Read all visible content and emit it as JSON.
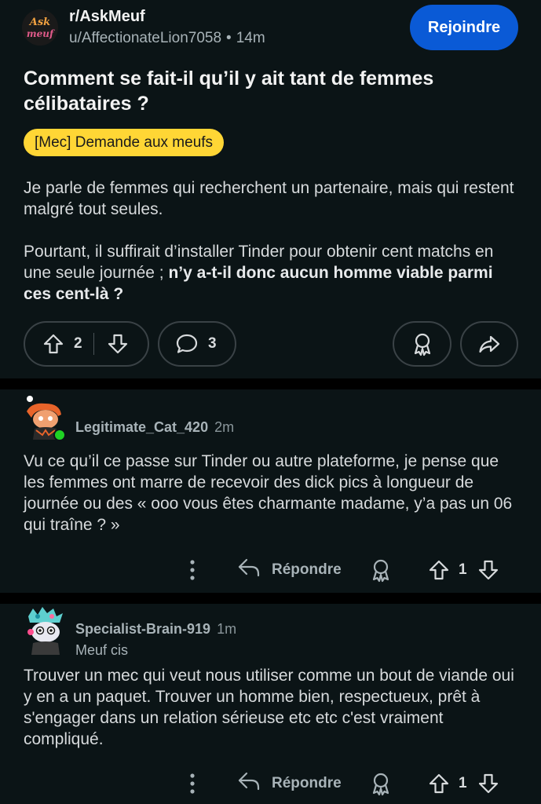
{
  "post": {
    "subreddit": "r/AskMeuf",
    "subreddit_logo_text": "Ask Meuf",
    "author": "u/AffectionateLion7058",
    "separator": "•",
    "time": "14m",
    "join_label": "Rejoindre",
    "title": "Comment se fait-il qu’il y ait tant de femmes célibataires ?",
    "flair": "[Mec] Demande aux meufs",
    "body_p1": "Je parle de femmes qui recherchent un partenaire, mais qui restent malgré tout seules.",
    "body_p2_plain": "Pourtant, il suffirait d’installer Tinder pour obtenir cent matchs en une seule journée ; ",
    "body_p2_bold": "n’y a-t-il donc aucun homme viable parmi ces cent-là ?",
    "score": "2",
    "comment_count": "3",
    "icons": [
      "upvote-icon",
      "downvote-icon",
      "comment-icon",
      "award-icon",
      "share-icon"
    ]
  },
  "comments": [
    {
      "username": "Legitimate_Cat_420",
      "time": "2m",
      "flair": "",
      "body": "Vu ce qu’il ce passe sur Tinder ou autre plateforme, je pense que les femmes ont marre de recevoir des dick pics à longueur de journée ou des « ooo vous êtes charmante madame, y’a pas un 06 qui traîne ? »",
      "reply_label": "Répondre",
      "score": "1",
      "online": true,
      "avatar_colors": {
        "hat": "#e8642a",
        "skin": "#f0a070",
        "shirt": "#2a2a2a"
      }
    },
    {
      "username": "Specialist-Brain-919",
      "time": "1m",
      "flair": "Meuf cis",
      "body": "Trouver un mec qui veut nous utiliser comme un bout de viande oui y en a un paquet. Trouver un homme bien, respectueux, prêt à s'engager dans un relation sérieuse etc etc c'est vraiment compliqué.",
      "reply_label": "Répondre",
      "score": "1",
      "online": false,
      "avatar_colors": {
        "hat": "#5ecfcf",
        "skin": "#e8e8f0",
        "shirt": "#3a3a3a"
      }
    }
  ],
  "colors": {
    "background": "#0b1416",
    "divider": "#000000",
    "join_button": "#0a5ad6",
    "flair_bg": "#ffd635",
    "online_dot": "#1fd224",
    "muted_text": "#a8b3b8"
  }
}
